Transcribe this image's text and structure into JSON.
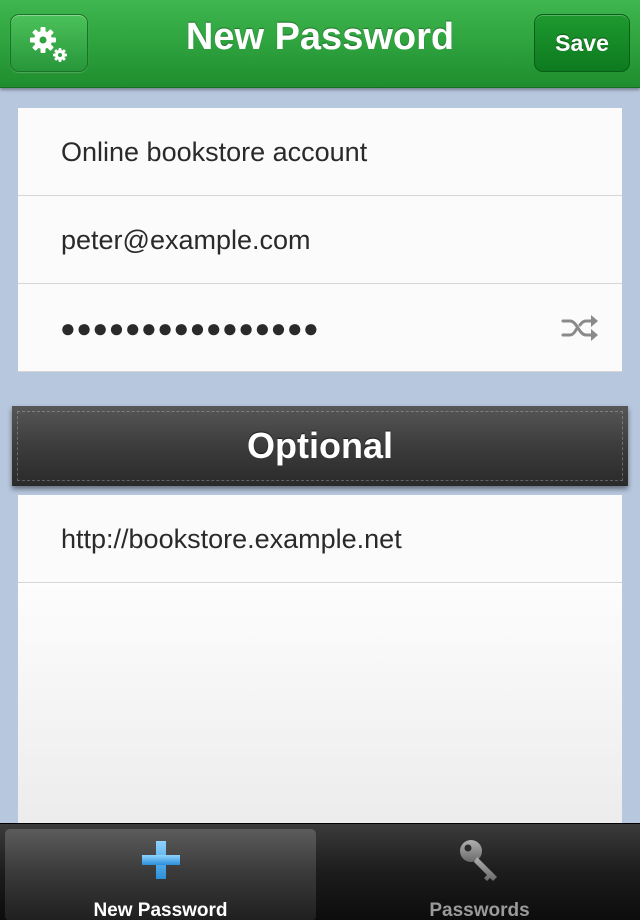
{
  "navbar": {
    "title": "New Password",
    "settings_icon": "gears-icon",
    "save_label": "Save"
  },
  "form": {
    "title_value": "Online bookstore account",
    "username_value": "peter@example.com",
    "password_masked": "●●●●●●●●●●●●●●●●",
    "shuffle_icon": "shuffle-icon"
  },
  "optional": {
    "header": "Optional",
    "url_value": "http://bookstore.example.net"
  },
  "tabbar": {
    "tabs": [
      {
        "label": "New Password",
        "icon": "plus-icon",
        "active": true
      },
      {
        "label": "Passwords",
        "icon": "key-icon",
        "active": false
      }
    ]
  },
  "colors": {
    "navbar_green": "#2ea33e",
    "save_green": "#0d7a1f",
    "background": "#b7c7de",
    "tab_active_icon": "#4aa8e6"
  }
}
